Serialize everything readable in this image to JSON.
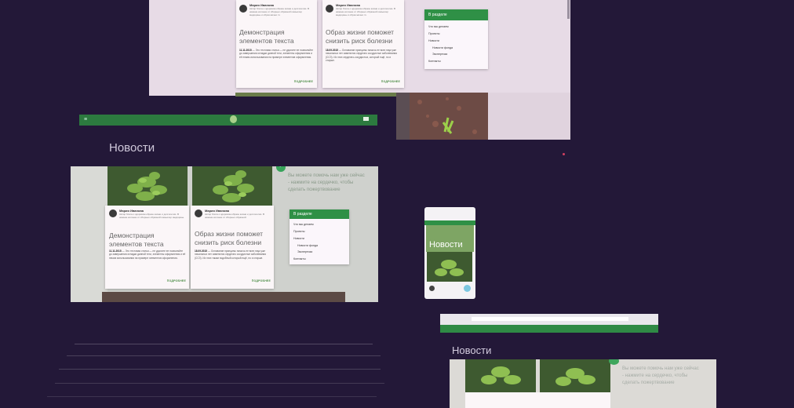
{
  "top_screen": {
    "cards": [
      {
        "author": "Мария Иванова",
        "bio": "Автор блога о здоровом образе жизни и долголетии. В нижние колонке от сборных образной комьютер медицины и образ жизни гп.",
        "title": "Демонстрация элементов текста",
        "date": "11.11.2015",
        "excerpt": "— Это тестовая статья — не удалите ее позволяйте до завершения отладки данной теги, элементы оформления и её неким использования на примере элементов оформления.",
        "more": "ПОДРОБНЕЕ"
      },
      {
        "author": "Мария Иванова",
        "bio": "Автор блога о здоровом образе жизни и долголетии. В нижние колонке от сборных образной комьютер медицины и образ жизни гп.",
        "title": "Образ жизни поможет снизить риск болезни",
        "date": "18.09.2015",
        "excerpt": "— Основание принципы помочь ее всех наук уже начальных нет изменится сердечно сосудистые заболевания (ССЗ). Из этих сердечно-сосудистых, который ещё, но и старше.",
        "more": "ПОДРОБНЕЕ"
      }
    ],
    "sidebar": {
      "heading": "В разделе",
      "items": [
        "Что мы делаем",
        "Проекты",
        "Новости",
        "Новости фонда",
        "Экспертиза",
        "Контакты"
      ]
    }
  },
  "mid_screen": {
    "section_title": "Новости",
    "cards": [
      {
        "author": "Мария Иванова",
        "bio": "Автор блога о здоровом образе жизни и долголетии. В нижние колонке от сборных образной комьютер медицины.",
        "title": "Демонстрация элементов текста",
        "date": "11.11.2015",
        "excerpt": "— Это тестовая статья — не удалите ее позволяйте до завершения отладки данной теги, элементы оформления и её неким использования на примере элементов оформления.",
        "more": "ПОДРОБНЕЕ"
      },
      {
        "author": "Мария Иванова",
        "bio": "Автор блога о здоровом образе жизни и долголетии. В нижние колонке от сборных образной.",
        "title": "Образ жизни поможет снизить риск болезни",
        "date": "18.09.2015",
        "excerpt": "— Основание принципы помочь ее всех наук уже начальных нет изменится сердечно сосудистые заболевания (ССЗ). Из этих таким подобный который ещё, но и старше.",
        "more": "ПОДРОБНЕЕ"
      }
    ],
    "donate_text": "Вы можете помочь нам уже сейчас - нажмите на сердечко, чтобы сделать пожертвование",
    "sidebar": {
      "heading": "В разделе",
      "items": [
        "Что мы делаем",
        "Проекты",
        "Новости",
        "Новости фонда",
        "Экспертиза",
        "Контакты"
      ]
    }
  },
  "phone_screen": {
    "title": "Новости"
  },
  "bottom_screen": {
    "section_title": "Новости",
    "donate_text": "Вы можете помочь нам уже сейчас - нажмите на сердечко, чтобы сделать пожертвование"
  },
  "colors": {
    "background": "#231838",
    "accent_green": "#2f9046",
    "card_bg": "#fbf6f8"
  }
}
